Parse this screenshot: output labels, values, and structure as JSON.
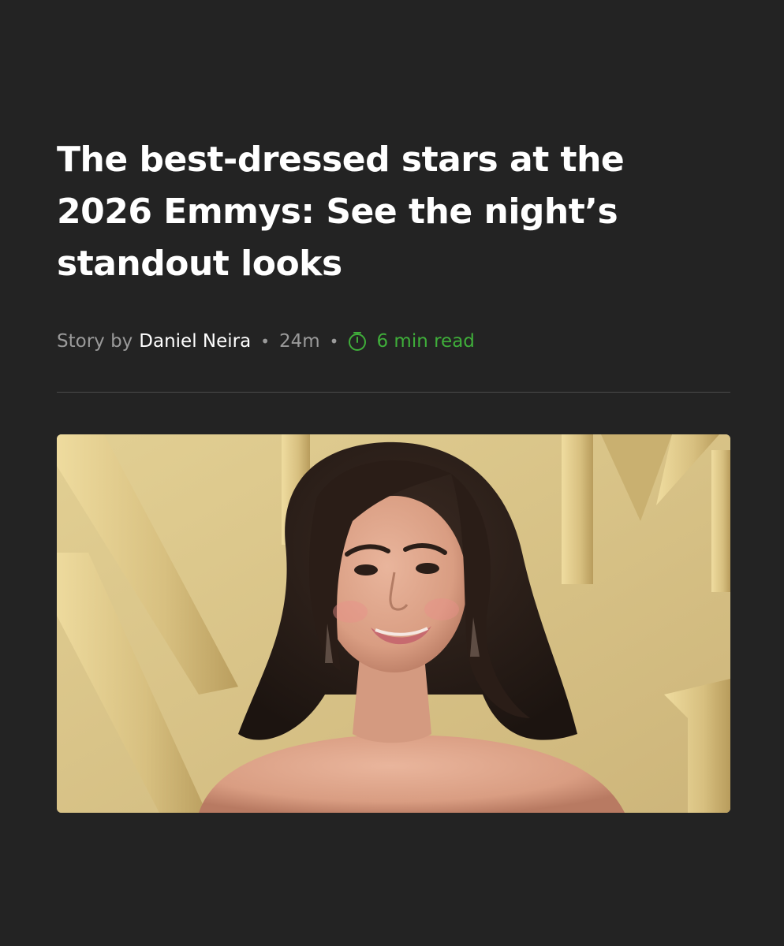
{
  "article": {
    "headline": "The best-dressed stars at the 2026 Emmys: See the night’s standout looks",
    "byline_prefix": "Story by",
    "author": "Daniel Neira",
    "separator": "•",
    "age": "24m",
    "read_time": "6 min read",
    "hero_image": {
      "alt": "Woman with dark wavy hair smiling in front of a gold Emmys backdrop"
    }
  },
  "colors": {
    "background": "#232323",
    "headline": "#ffffff",
    "muted": "#9a9a9a",
    "read_time_accent": "#3fae3a",
    "divider": "#4a4a4a"
  },
  "icons": {
    "read_time": "stopwatch-icon"
  }
}
